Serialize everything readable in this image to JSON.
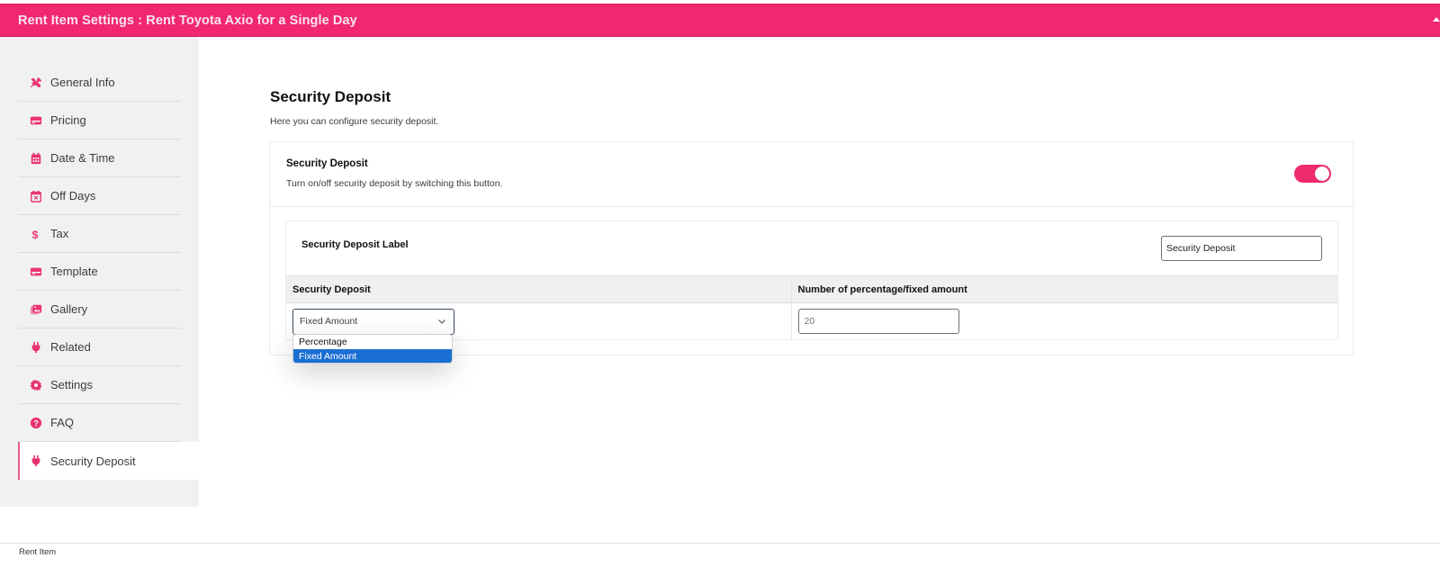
{
  "header": {
    "title": "Rent Item Settings : Rent Toyota Axio for a Single Day",
    "collapse_icon": "triangle-up-icon"
  },
  "colors": {
    "accent": "#f1286f",
    "selected_option": "#1b6fd3"
  },
  "sidebar": {
    "items": [
      {
        "label": "General Info",
        "icon": "tools-icon",
        "active": false
      },
      {
        "label": "Pricing",
        "icon": "card-icon",
        "active": false
      },
      {
        "label": "Date & Time",
        "icon": "calendar-icon",
        "active": false
      },
      {
        "label": "Off Days",
        "icon": "calendar-x-icon",
        "active": false
      },
      {
        "label": "Tax",
        "icon": "dollar-icon",
        "active": false
      },
      {
        "label": "Template",
        "icon": "card-icon",
        "active": false
      },
      {
        "label": "Gallery",
        "icon": "images-icon",
        "active": false
      },
      {
        "label": "Related",
        "icon": "plug-icon",
        "active": false
      },
      {
        "label": "Settings",
        "icon": "gear-icon",
        "active": false
      },
      {
        "label": "FAQ",
        "icon": "question-icon",
        "active": false
      },
      {
        "label": "Security Deposit",
        "icon": "plug-icon",
        "active": true
      }
    ]
  },
  "main": {
    "title": "Security Deposit",
    "description": "Here you can configure security deposit.",
    "toggle": {
      "title": "Security Deposit",
      "description": "Turn on/off security deposit by switching this button.",
      "enabled": true
    },
    "label_field": {
      "label": "Security Deposit Label",
      "value": "Security Deposit"
    },
    "table": {
      "headers": [
        "Security Deposit",
        "Number of percentage/fixed amount"
      ],
      "type_select": {
        "value": "Fixed Amount",
        "options": [
          "Percentage",
          "Fixed Amount"
        ],
        "open": true
      },
      "amount_value": "20"
    }
  },
  "footer": {
    "text": "Rent Item"
  }
}
